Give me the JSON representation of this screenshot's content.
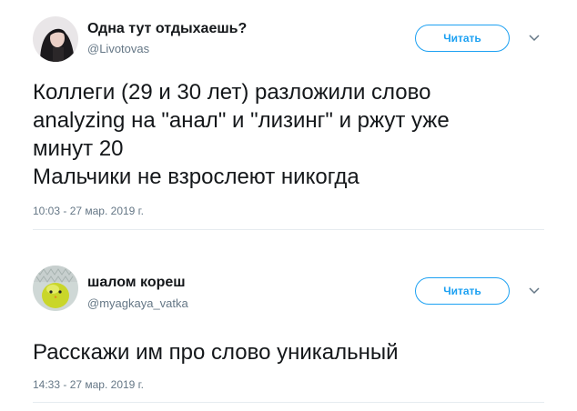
{
  "colors": {
    "accent": "#1da1f2",
    "secondary_text": "#657786",
    "primary_text": "#14171a",
    "divider": "#e6ecf0"
  },
  "tweets": [
    {
      "author_name": "Одна тут отдыхаешь?",
      "author_handle": "@Livotovas",
      "follow_label": "Читать",
      "menu_icon": "chevron-down-icon",
      "text": "Коллеги (29 и 30 лет) разложили слово\nanalyzing на \"анал\" и \"лизинг\" и ржут уже\nминут 20\nМальчики не взрослеют никогда",
      "timestamp": "10:03 - 27 мар. 2019 г."
    },
    {
      "author_name": "шалом кореш",
      "author_handle": "@myagkaya_vatka",
      "follow_label": "Читать",
      "menu_icon": "chevron-down-icon",
      "text": "Расскажи им про слово уникальный",
      "timestamp": "14:33 - 27 мар. 2019 г."
    }
  ]
}
